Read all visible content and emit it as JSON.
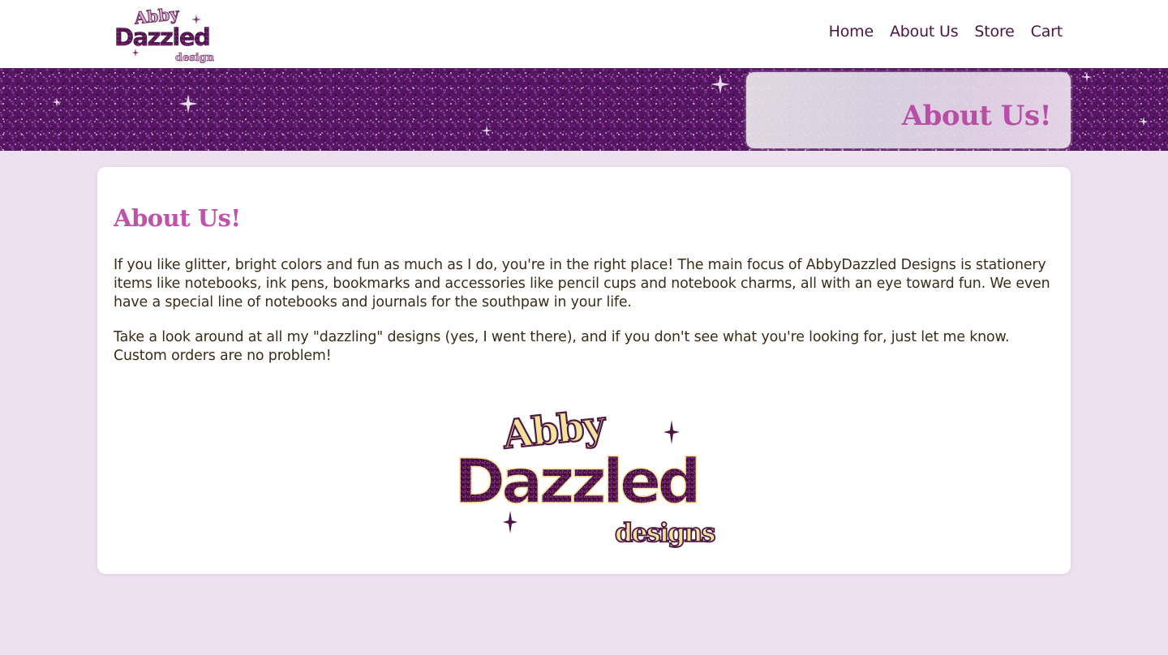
{
  "brand": {
    "logo_line1": "Abby",
    "logo_line2": "Dazzled",
    "logo_line3": "designs"
  },
  "nav": {
    "items": [
      {
        "label": "Home"
      },
      {
        "label": "About Us"
      },
      {
        "label": "Store"
      },
      {
        "label": "Cart"
      }
    ]
  },
  "banner": {
    "title": "About Us!"
  },
  "main": {
    "title": "About Us!",
    "paragraphs": [
      "If you like glitter, bright colors and fun as much as I do, you're in the right place! The main focus of AbbyDazzled Designs is stationery items like notebooks, ink pens, bookmarks and accessories like pencil cups and notebook charms, all with an eye toward fun. We even have a special line of notebooks and journals for the southpaw in your life.",
      "Take a look around at all my \"dazzling\" designs (yes, I went there), and if you don't see what you're looking for, just let me know. Custom orders are no problem!"
    ]
  },
  "colors": {
    "page_background": "#ede1ef",
    "nav_text": "#4b1447",
    "heading_pink": "#c052a9",
    "glitter_purple": "#5a1a68",
    "body_text": "#3a2c18"
  }
}
